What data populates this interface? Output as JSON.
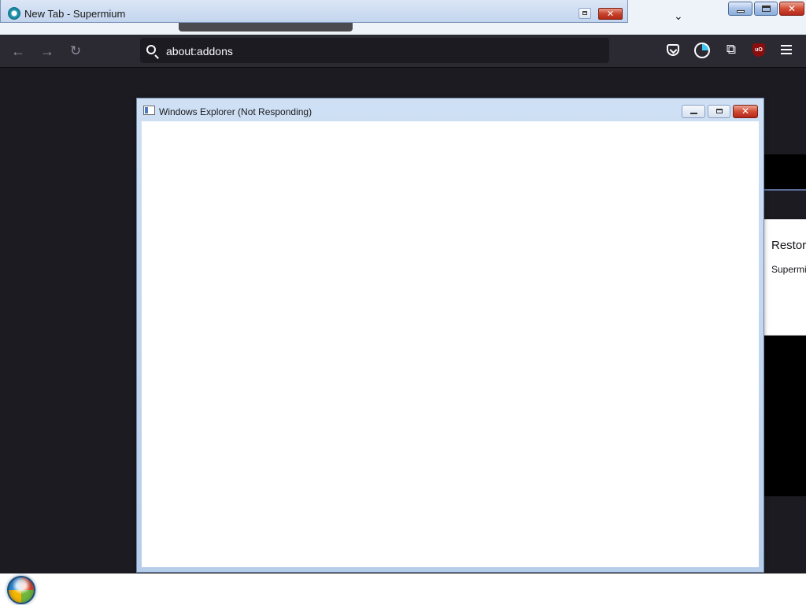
{
  "outer_window": {
    "tab_title": "New Tab - Supermium",
    "close_glyph": "✕",
    "chevron_glyph": "⌄"
  },
  "toolbar": {
    "back_glyph": "←",
    "forward_glyph": "→",
    "reload_glyph": "↻",
    "url_value": "about:addons",
    "extensions_glyph": "⧉",
    "ublock_label": "uO"
  },
  "restore_popup": {
    "title": "Restor",
    "body": "Supermi"
  },
  "explorer_window": {
    "title": "Windows Explorer (Not Responding)",
    "close_glyph": "✕"
  },
  "colors": {
    "toolbar_bg": "#2b2a33",
    "content_bg": "#1c1b22",
    "url_bg": "#1c1b22",
    "close_red": "#c8442e"
  }
}
